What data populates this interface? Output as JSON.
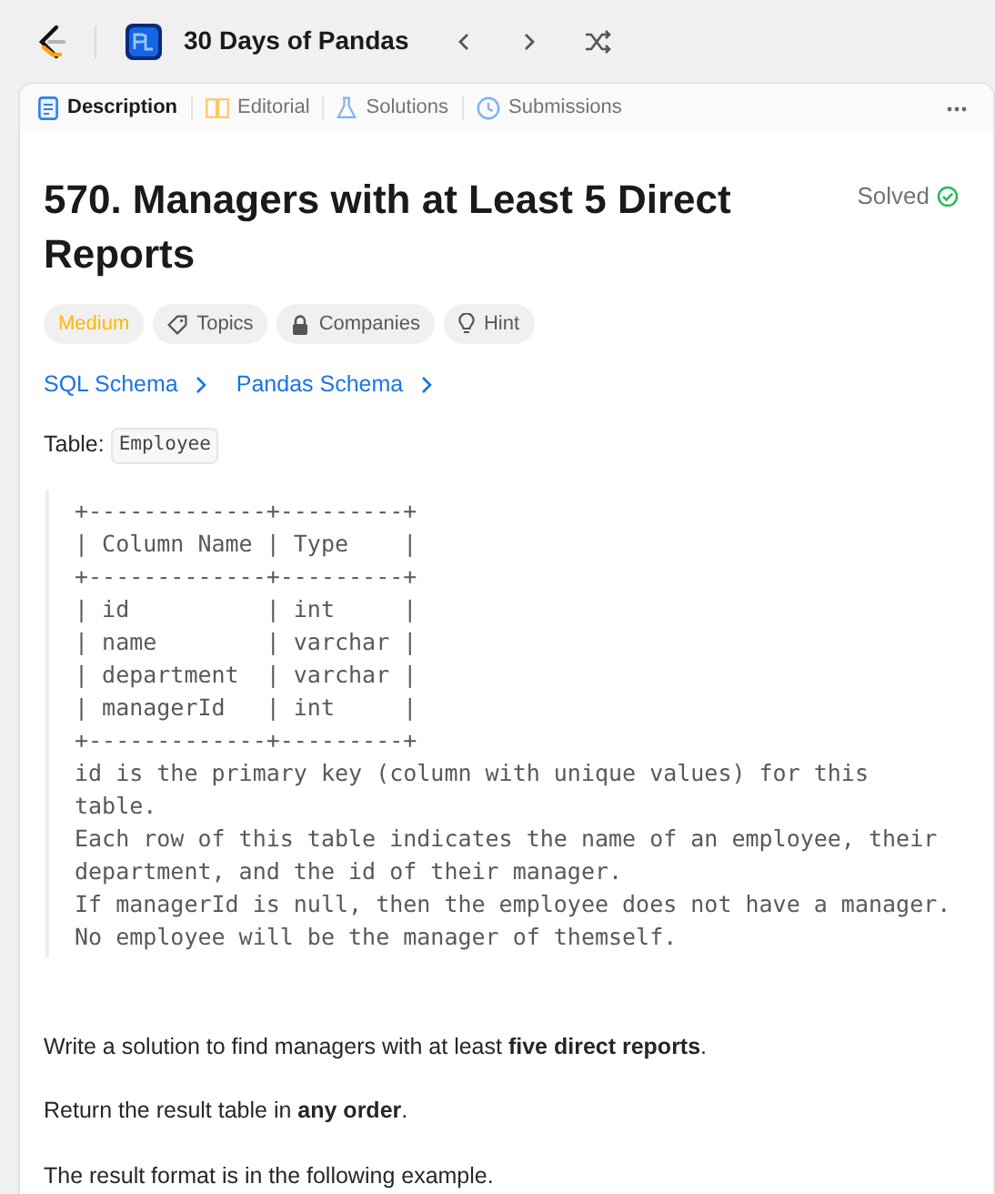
{
  "topbar": {
    "list_title": "30 Days of Pandas"
  },
  "tabs": [
    {
      "label": "Description",
      "kind": "description",
      "selected": true
    },
    {
      "label": "Editorial",
      "kind": "editorial",
      "selected": false
    },
    {
      "label": "Solutions",
      "kind": "solutions",
      "selected": false
    },
    {
      "label": "Submissions",
      "kind": "submissions",
      "selected": false
    }
  ],
  "problem": {
    "title": "570. Managers with at Least 5 Direct Reports",
    "status": "Solved",
    "tags": [
      {
        "label": "Medium",
        "kind": "difficulty"
      },
      {
        "label": "Topics",
        "kind": "topics"
      },
      {
        "label": "Companies",
        "kind": "companies"
      },
      {
        "label": "Hint",
        "kind": "hint"
      }
    ],
    "schema_links": [
      "SQL Schema",
      "Pandas Schema"
    ],
    "table_label": "Table:",
    "table_name": "Employee",
    "code_block": [
      "+-------------+---------+",
      "| Column Name | Type    |",
      "+-------------+---------+",
      "| id          | int     |",
      "| name        | varchar |",
      "| department  | varchar |",
      "| managerId   | int     |",
      "+-------------+---------+",
      "id is the primary key (column with unique values) for this",
      "table.",
      "Each row of this table indicates the name of an employee, their",
      "department, and the id of their manager.",
      "If managerId is null, then the employee does not have a manager.",
      "No employee will be the manager of themself."
    ],
    "paragraphs": [
      "Write a solution to find managers with at least **five direct reports**.",
      "Return the result table in **any order**.",
      "The result format is in the following example."
    ]
  }
}
